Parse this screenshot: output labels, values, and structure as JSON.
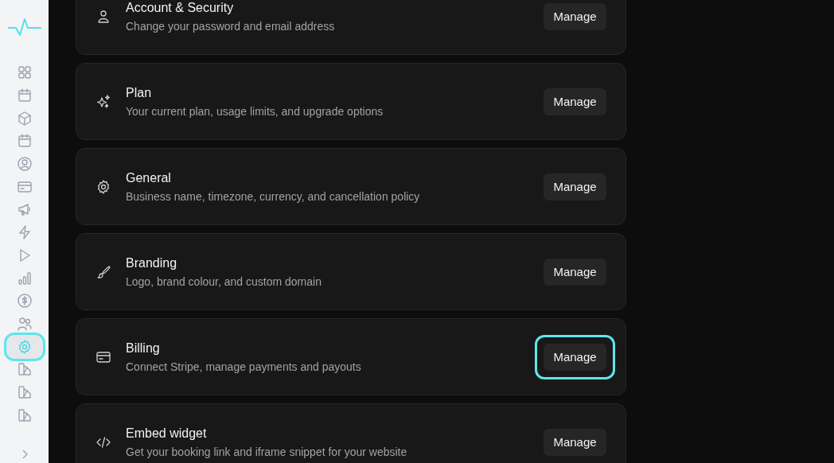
{
  "sidebar": {
    "items": [
      {
        "selected": false
      },
      {
        "selected": false
      },
      {
        "selected": false
      },
      {
        "selected": false
      },
      {
        "selected": false
      },
      {
        "selected": false
      },
      {
        "selected": false
      },
      {
        "selected": false
      },
      {
        "selected": false
      },
      {
        "selected": false
      },
      {
        "selected": false
      },
      {
        "selected": false
      },
      {
        "selected": true
      },
      {
        "selected": false
      },
      {
        "selected": false
      },
      {
        "selected": false
      }
    ]
  },
  "settings": [
    {
      "title": "Account & Security",
      "description": "Change your password and email address",
      "button": "Manage",
      "focused": false
    },
    {
      "title": "Plan",
      "description": "Your current plan, usage limits, and upgrade options",
      "button": "Manage",
      "focused": false
    },
    {
      "title": "General",
      "description": "Business name, timezone, currency, and cancellation policy",
      "button": "Manage",
      "focused": false
    },
    {
      "title": "Branding",
      "description": "Logo, brand colour, and custom domain",
      "button": "Manage",
      "focused": false
    },
    {
      "title": "Billing",
      "description": "Connect Stripe, manage payments and payouts",
      "button": "Manage",
      "focused": true
    },
    {
      "title": "Embed widget",
      "description": "Get your booking link and iframe snippet for your website",
      "button": "Manage",
      "focused": false
    }
  ]
}
